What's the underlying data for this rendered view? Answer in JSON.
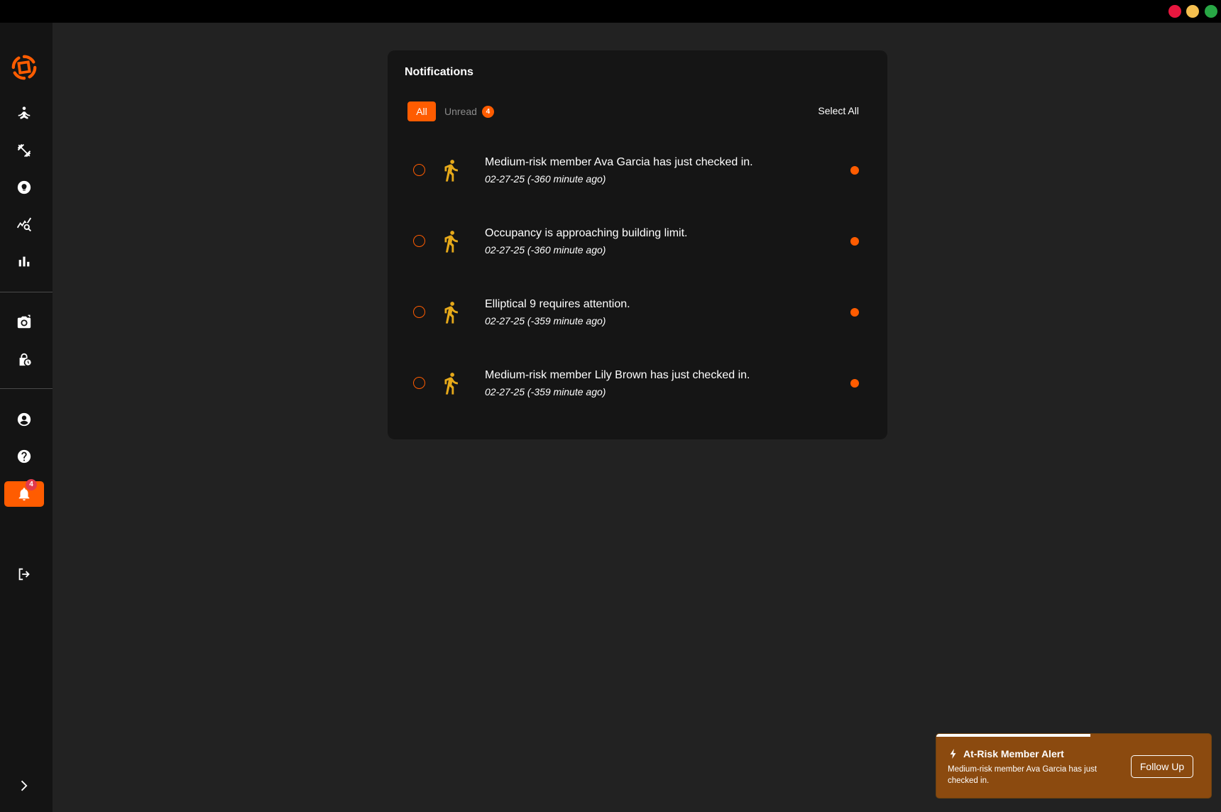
{
  "colors": {
    "accent": "#ff5c00",
    "toast_bg": "#8b4a0f",
    "run_icon": "#e6a91a",
    "traffic_red": "#e8173f",
    "traffic_yellow": "#f5bf4f",
    "traffic_green": "#28a745"
  },
  "sidebar": {
    "items": [
      {
        "icon": "meditation-icon"
      },
      {
        "icon": "dumbbell-icon"
      },
      {
        "icon": "lightbulb-icon"
      },
      {
        "icon": "chart-search-icon"
      },
      {
        "icon": "bar-chart-icon"
      },
      {
        "icon": "camera-icon"
      },
      {
        "icon": "lock-clock-icon"
      },
      {
        "icon": "user-circle-icon"
      },
      {
        "icon": "help-icon"
      },
      {
        "icon": "bell-icon",
        "badge": "4",
        "active": true
      },
      {
        "icon": "logout-icon"
      },
      {
        "icon": "chevron-right-icon"
      }
    ]
  },
  "notifications": {
    "title": "Notifications",
    "tabs": {
      "all_label": "All",
      "unread_label": "Unread",
      "unread_count": "4"
    },
    "select_all_label": "Select All",
    "items": [
      {
        "text": "Medium-risk member Ava Garcia has just checked in.",
        "time": "02-27-25 (-360 minute ago)",
        "icon": "running-person-icon",
        "unread": true
      },
      {
        "text": "Occupancy is approaching building limit.",
        "time": "02-27-25 (-360 minute ago)",
        "icon": "running-person-icon",
        "unread": true
      },
      {
        "text": "Elliptical 9 requires attention.",
        "time": "02-27-25 (-359 minute ago)",
        "icon": "running-person-icon",
        "unread": true
      },
      {
        "text": "Medium-risk member Lily Brown has just checked in.",
        "time": "02-27-25 (-359 minute ago)",
        "icon": "running-person-icon",
        "unread": true
      }
    ]
  },
  "toast": {
    "icon": "lightning-icon",
    "title": "At-Risk Member Alert",
    "message": "Medium-risk member Ava Garcia has just checked in.",
    "button_label": "Follow Up",
    "progress": 0.56
  }
}
